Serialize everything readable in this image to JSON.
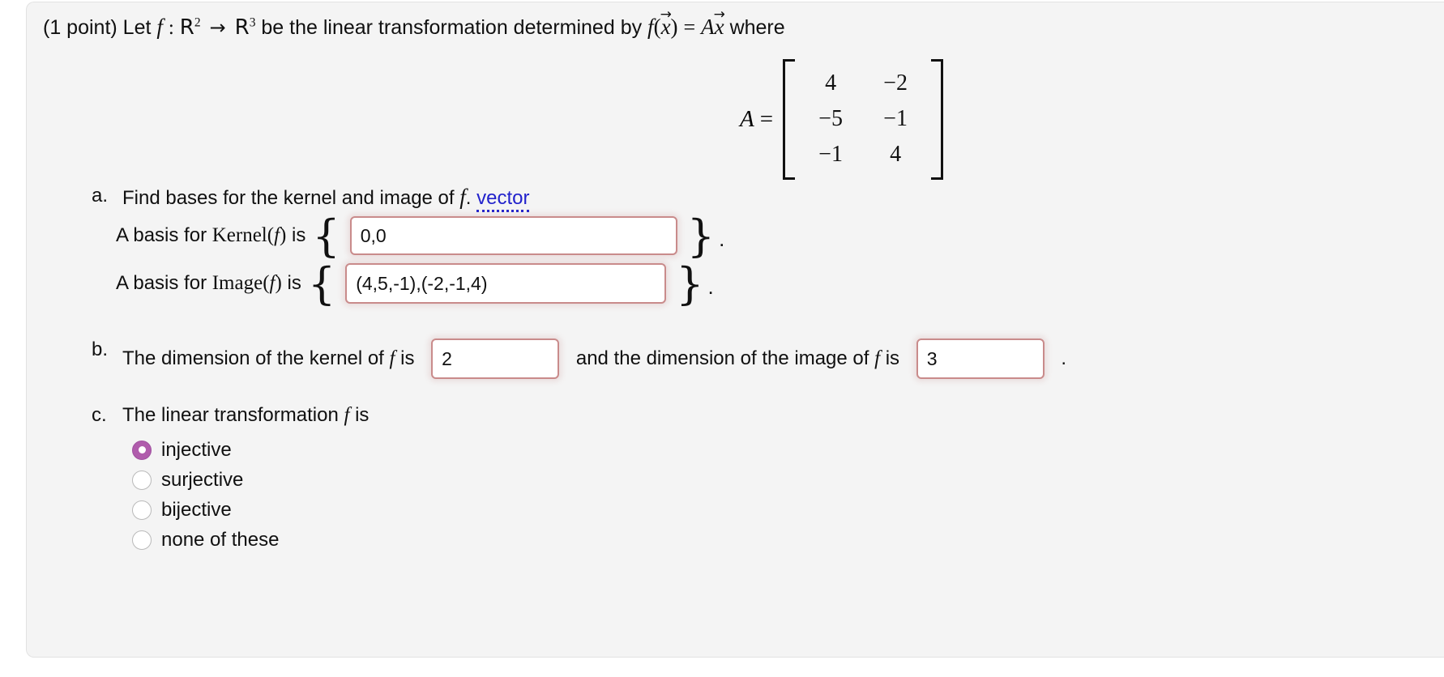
{
  "problem": {
    "points_label": "(1 point)",
    "statement_pre": "Let",
    "f_symbol": "f",
    "colon": ":",
    "domain_set": "R",
    "domain_exp": "2",
    "arrow": "→",
    "codomain_set": "R",
    "codomain_exp": "3",
    "statement_mid": "be the linear transformation determined by",
    "map_f": "f",
    "map_open": "(",
    "map_x": "x",
    "map_close": ")",
    "map_eq": "=",
    "map_A": "A",
    "map_x2": "x",
    "statement_end": "where"
  },
  "matrix": {
    "label": "A",
    "equals": "=",
    "rows": [
      [
        "4",
        "−2"
      ],
      [
        "−5",
        "−1"
      ],
      [
        "−1",
        "4"
      ]
    ]
  },
  "parts": {
    "a": {
      "marker": "a.",
      "prompt_pre": "Find bases for the kernel and image of",
      "prompt_f": "f",
      "prompt_period": ".",
      "help_link": "vector",
      "kernel_row": {
        "label_pre": "A basis for",
        "label_fn": "Kernel(",
        "label_f": "f",
        "label_fn_close": ")",
        "label_post": "is",
        "brace_open": "{",
        "brace_close": "}",
        "trailing": ".",
        "value": "0,0",
        "placeholder": ""
      },
      "image_row": {
        "label_pre": "A basis for",
        "label_fn": "Image(",
        "label_f": "f",
        "label_fn_close": ")",
        "label_post": "is",
        "brace_open": "{",
        "brace_close": "}",
        "trailing": ".",
        "value": "(4,5,-1),(-2,-1,4)",
        "placeholder": ""
      }
    },
    "b": {
      "marker": "b.",
      "text_pre": "The dimension of the kernel of",
      "f1": "f",
      "is1": "is",
      "dim_kernel_value": "2",
      "text_mid": "and the dimension of the image of",
      "f2": "f",
      "is2": "is",
      "dim_image_value": "3",
      "trailing": "."
    },
    "c": {
      "marker": "c.",
      "text_pre": "The linear transformation",
      "f": "f",
      "is": "is",
      "options": [
        {
          "label": "injective",
          "selected": true
        },
        {
          "label": "surjective",
          "selected": false
        },
        {
          "label": "bijective",
          "selected": false
        },
        {
          "label": "none of these",
          "selected": false
        }
      ]
    }
  },
  "colors": {
    "card_background": "#f4f4f4",
    "input_border": "#c98b8b",
    "link": "#2222cc",
    "radio_selected": "#b05cac",
    "text": "#101010"
  }
}
